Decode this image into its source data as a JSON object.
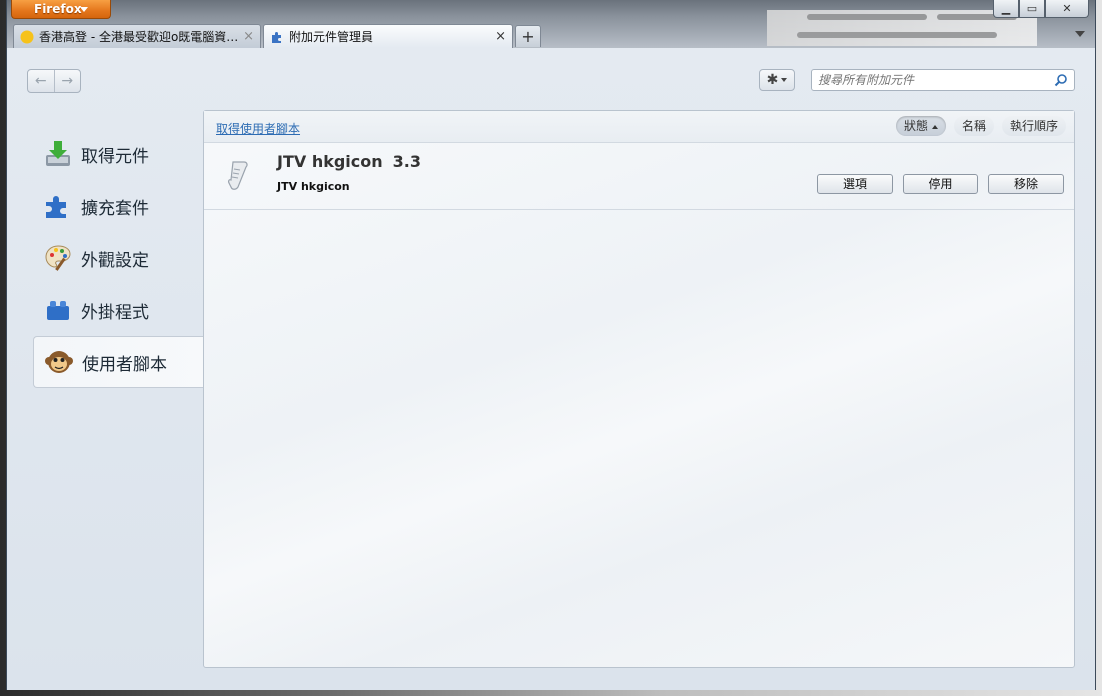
{
  "browser": {
    "menu_button": "Firefox",
    "tabs": [
      {
        "label": "香港高登 - 全港最受歡迎o既電腦資…",
        "close": "×",
        "active": false
      },
      {
        "label": "附加元件管理員",
        "close": "×",
        "active": true
      }
    ],
    "new_tab": "+"
  },
  "toolbar": {
    "back_label": "←",
    "forward_label": "→",
    "search_placeholder": "搜尋所有附加元件"
  },
  "sidebar": {
    "items": [
      {
        "label": "取得元件",
        "icon": "download-icon"
      },
      {
        "label": "擴充套件",
        "icon": "puzzle-icon"
      },
      {
        "label": "外觀設定",
        "icon": "palette-icon"
      },
      {
        "label": "外掛程式",
        "icon": "lego-brick-icon"
      },
      {
        "label": "使用者腳本",
        "icon": "monkey-icon",
        "selected": true
      }
    ]
  },
  "main": {
    "get_link": "取得使用者腳本",
    "sort": [
      {
        "label": "狀態",
        "active": true
      },
      {
        "label": "名稱",
        "active": false
      },
      {
        "label": "執行順序",
        "active": false
      }
    ],
    "addons": [
      {
        "name": "JTV hkgicon",
        "version": "3.3",
        "description": "JTV hkgicon",
        "icon": "script-icon",
        "buttons": {
          "options": "選項",
          "disable": "停用",
          "remove": "移除"
        }
      }
    ]
  },
  "colors": {
    "accent": "#e4761c",
    "link": "#2d6cb3",
    "panel_border": "#b9c3ce"
  }
}
